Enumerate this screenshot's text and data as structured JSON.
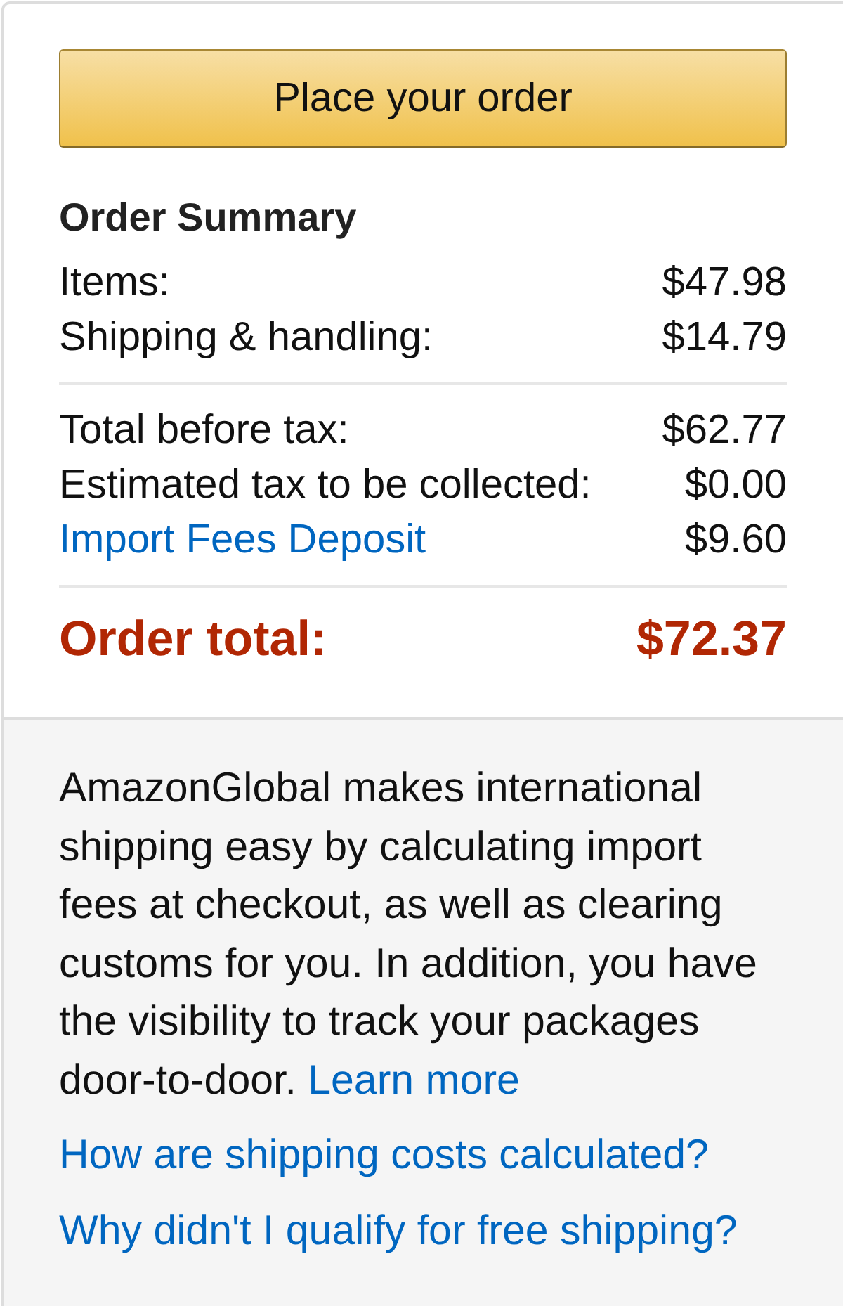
{
  "button": {
    "label": "Place your order"
  },
  "summary": {
    "title": "Order Summary",
    "groups": [
      [
        {
          "kind": "plain",
          "label": "Items:",
          "amount": "$47.98"
        },
        {
          "kind": "plain",
          "label": "Shipping & handling:",
          "amount": "$14.79"
        }
      ],
      [
        {
          "kind": "plain",
          "label": "Total before tax:",
          "amount": "$62.77"
        },
        {
          "kind": "plain",
          "label": "Estimated tax to be collected:",
          "amount": "$0.00"
        },
        {
          "kind": "link",
          "label": "Import Fees Deposit",
          "amount": "$9.60"
        }
      ]
    ],
    "total": {
      "label": "Order total:",
      "amount": "$72.37"
    }
  },
  "info": {
    "text": "AmazonGlobal makes international shipping easy by calculating import fees at checkout, as well as clearing customs for you. In addition, you have the visibility to track your packages door-to-door.",
    "link": "Learn more"
  },
  "links": [
    "How are shipping costs calculated?",
    "Why didn't I qualify for free shipping?"
  ]
}
